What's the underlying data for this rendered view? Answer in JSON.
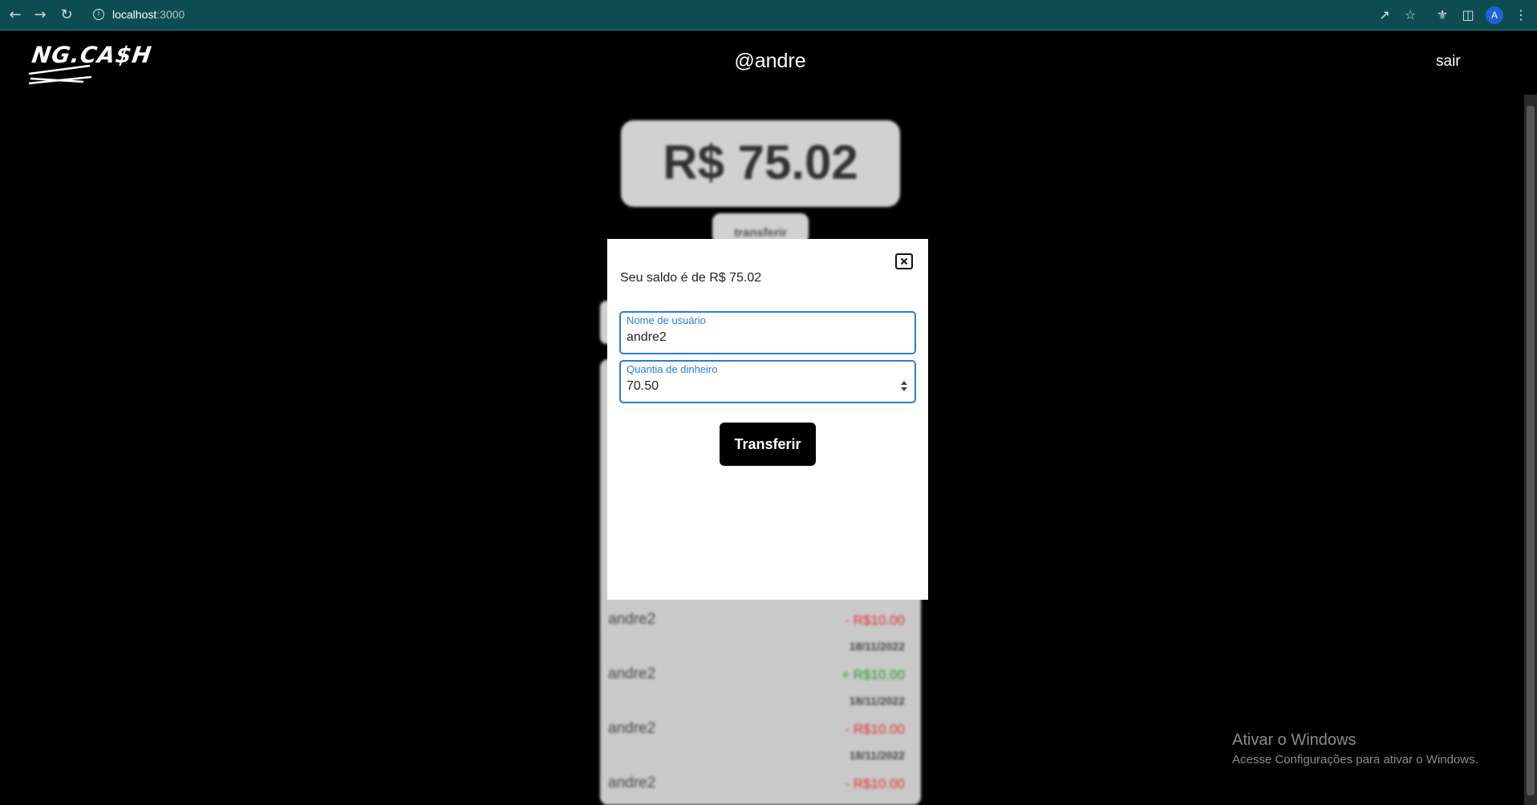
{
  "browser": {
    "url_host": "localhost",
    "url_port": ":3000",
    "profile_initial": "A"
  },
  "header": {
    "logo_text": "NG.CA$H",
    "username": "@andre",
    "logout_label": "sair"
  },
  "background": {
    "balance": "R$ 75.02",
    "transfer_button_label": "transferir",
    "transactions": [
      {
        "name": "andre2",
        "amount": "- R$10.00",
        "type": "debit",
        "date": "18/11/2022"
      },
      {
        "name": "andre2",
        "amount": "+ R$10.00",
        "type": "credit",
        "date": "18/11/2022"
      },
      {
        "name": "andre2",
        "amount": "- R$10.00",
        "type": "debit",
        "date": "18/11/2022"
      },
      {
        "name": "andre2",
        "amount": "- R$10.00",
        "type": "debit",
        "date": ""
      }
    ],
    "debit_color": "#e03030",
    "credit_color": "#2a9a2a"
  },
  "modal": {
    "saldo_text": "Seu saldo é de R$ 75.02",
    "username_field": {
      "label": "Nome de usuário",
      "value": "andre2"
    },
    "amount_field": {
      "label": "Quantia de dinheiro",
      "value": "70.50"
    },
    "submit_label": "Transferir",
    "accent_color": "#2a7ed4"
  },
  "watermark": {
    "title": "Ativar o Windows",
    "subtitle": "Acesse Configurações para ativar o Windows."
  }
}
